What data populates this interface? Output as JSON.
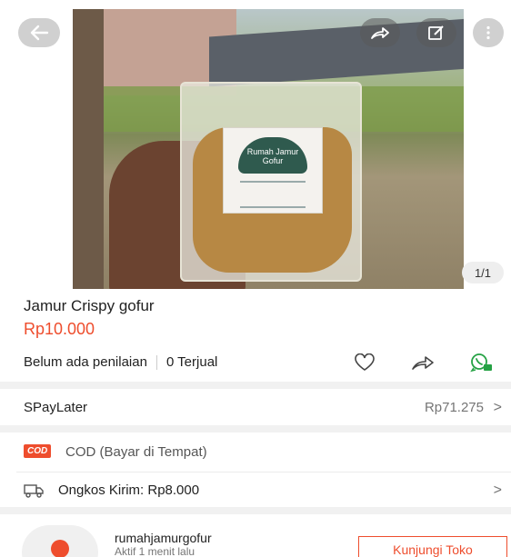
{
  "gallery": {
    "counter": "1/1",
    "package_label_line1": "Rumah Jamur",
    "package_label_line2": "Gofur"
  },
  "product": {
    "title": "Jamur Crispy gofur",
    "price": "Rp10.000",
    "rating_text": "Belum ada penilaian",
    "sold_text": "0 Terjual"
  },
  "paylater": {
    "label": "SPayLater",
    "amount": "Rp71.275",
    "chevron": ">"
  },
  "cod": {
    "badge": "COD",
    "label": "COD (Bayar di Tempat)"
  },
  "shipping": {
    "label": "Ongkos Kirim: Rp8.000",
    "chevron": ">"
  },
  "shop": {
    "name": "rumahjamurgofur",
    "status": "Aktif 1 menit lalu",
    "visit_label": "Kunjungi Toko"
  },
  "icons": [
    "back-arrow-icon",
    "share-icon",
    "edit-icon",
    "more-vertical-icon",
    "heart-icon",
    "share-outline-icon",
    "whatsapp-icon",
    "truck-icon",
    "avatar-icon"
  ],
  "colors": {
    "accent": "#ee4d2d",
    "whatsapp": "#25a244"
  }
}
